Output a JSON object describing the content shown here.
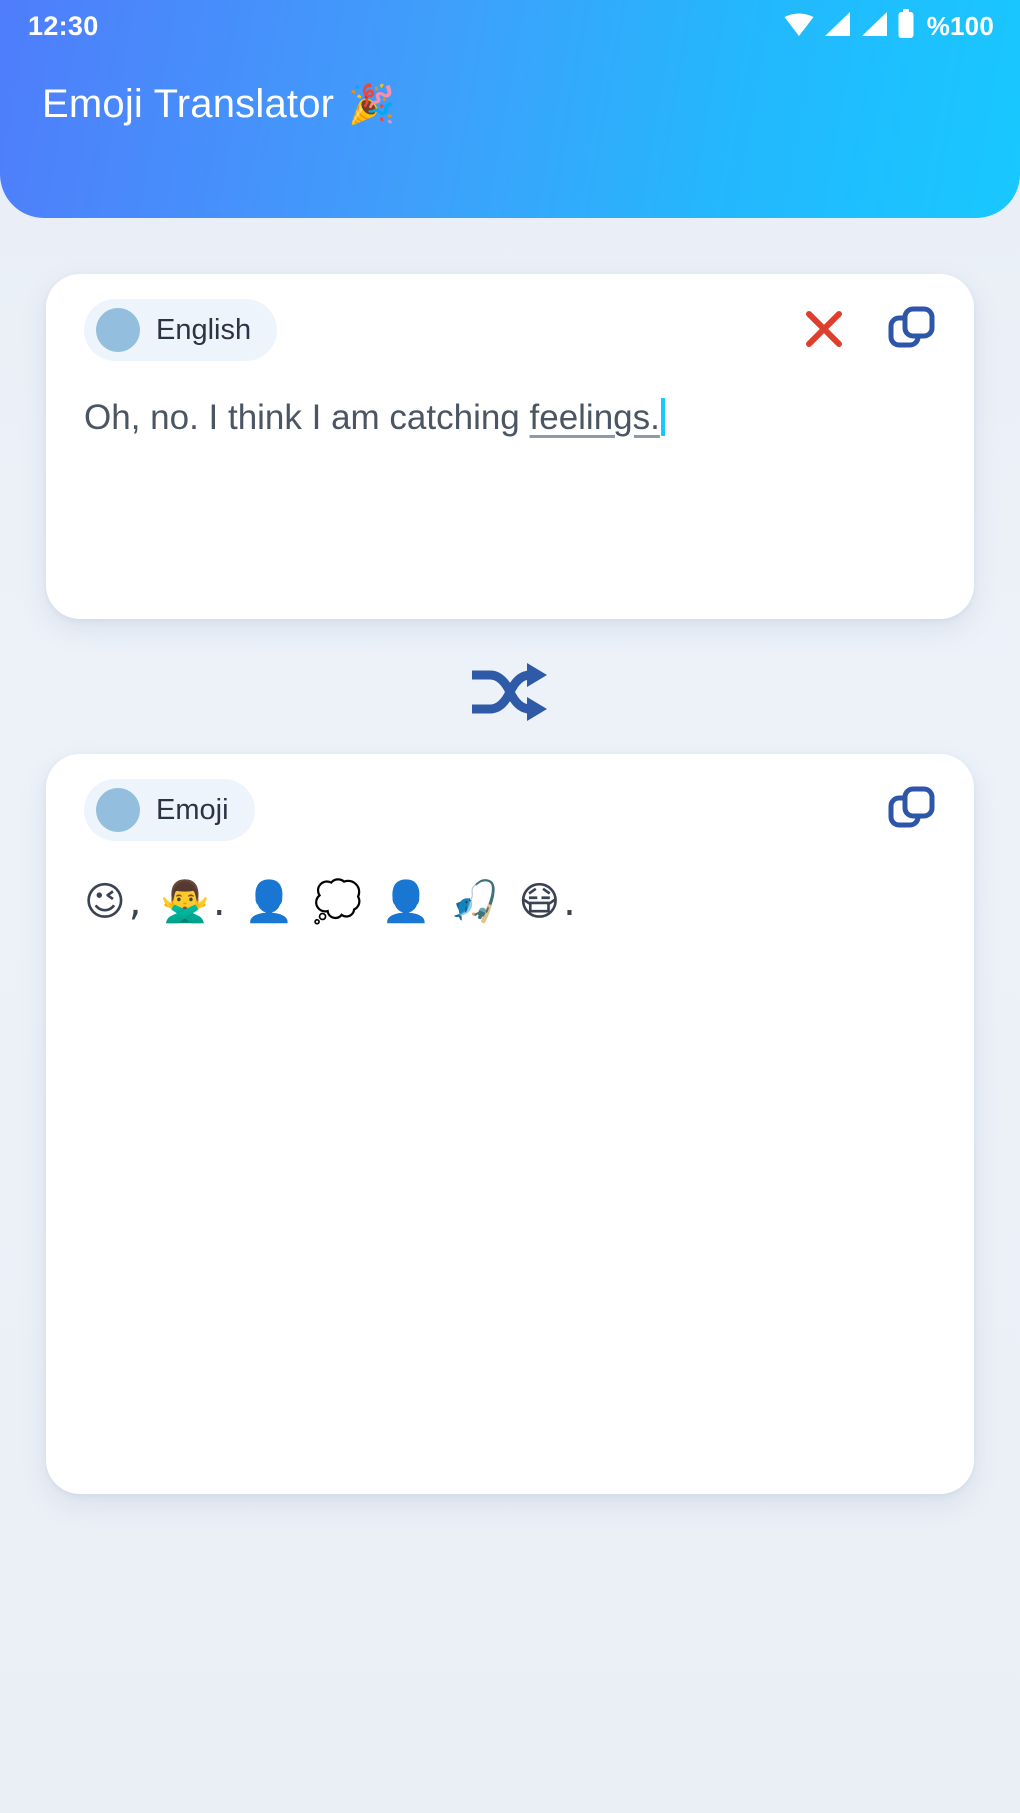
{
  "status_bar": {
    "time": "12:30",
    "battery_label": "%100",
    "icons": [
      "wifi-icon",
      "signal-icon",
      "signal-icon",
      "battery-icon"
    ]
  },
  "header": {
    "title": "Emoji Translator",
    "title_emoji": "🎉",
    "gradient_from": "#4f7dfb",
    "gradient_to": "#18c8ff"
  },
  "input_card": {
    "language_label": "English",
    "language_dot_color": "#93bedd",
    "text_before": "Oh, no. I think I am catching ",
    "text_underlined": "feelings.",
    "clear_label": "clear-icon",
    "clear_color": "#e03e2d",
    "copy_label": "copy-icon",
    "copy_color": "#2d55a8"
  },
  "swap": {
    "label": "shuffle-icon",
    "color": "#2f5aa8"
  },
  "output_card": {
    "language_label": "Emoji",
    "language_dot_color": "#93bedd",
    "emoji_text": "😉, 🙅‍♂️. 👤 💭 👤 🎣 😷.",
    "copy_label": "copy-icon",
    "copy_color": "#2d55a8"
  }
}
